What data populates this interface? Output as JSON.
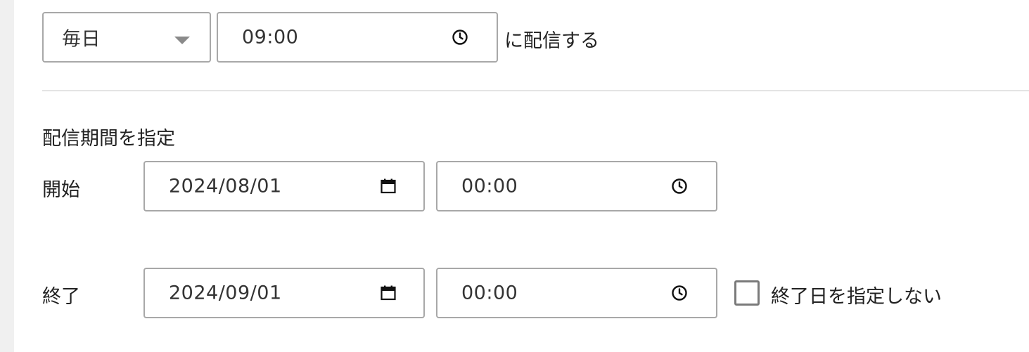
{
  "schedule": {
    "frequency": {
      "selected": "毎日"
    },
    "time": {
      "value": "09:00"
    },
    "suffix": "に配信する"
  },
  "period": {
    "title": "配信期間を指定",
    "start": {
      "label": "開始",
      "date": "2024/08/01",
      "time": "00:00"
    },
    "end": {
      "label": "終了",
      "date": "2024/09/01",
      "time": "00:00"
    },
    "no_end_date": {
      "label": "終了日を指定しない",
      "checked": false
    }
  },
  "icons": {
    "clock": "clock-icon",
    "calendar": "calendar-icon",
    "dropdown": "chevron-down-icon"
  }
}
